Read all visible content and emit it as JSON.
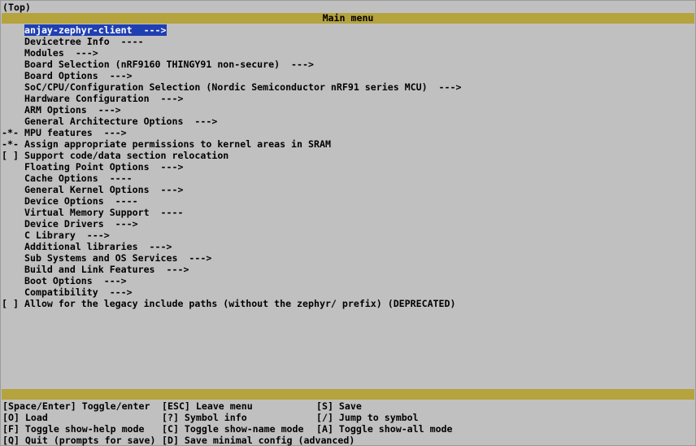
{
  "breadcrumb": "(Top)",
  "title": "Main menu",
  "menu": [
    {
      "prefix": "",
      "text": "anjay-zephyr-client  --->",
      "selected": true
    },
    {
      "prefix": "",
      "text": "Devicetree Info  ----"
    },
    {
      "prefix": "",
      "text": "Modules  --->"
    },
    {
      "prefix": "",
      "text": "Board Selection (nRF9160 THINGY91 non-secure)  --->"
    },
    {
      "prefix": "",
      "text": "Board Options  --->"
    },
    {
      "prefix": "",
      "text": "SoC/CPU/Configuration Selection (Nordic Semiconductor nRF91 series MCU)  --->"
    },
    {
      "prefix": "",
      "text": "Hardware Configuration  --->"
    },
    {
      "prefix": "",
      "text": "ARM Options  --->"
    },
    {
      "prefix": "",
      "text": "General Architecture Options  --->"
    },
    {
      "prefix": "-*-",
      "text": "MPU features  --->"
    },
    {
      "prefix": "-*-",
      "text": "Assign appropriate permissions to kernel areas in SRAM"
    },
    {
      "prefix": "[ ]",
      "text": "Support code/data section relocation"
    },
    {
      "prefix": "",
      "text": "Floating Point Options  --->"
    },
    {
      "prefix": "",
      "text": "Cache Options  ----"
    },
    {
      "prefix": "",
      "text": "General Kernel Options  --->"
    },
    {
      "prefix": "",
      "text": "Device Options  ----"
    },
    {
      "prefix": "",
      "text": "Virtual Memory Support  ----"
    },
    {
      "prefix": "",
      "text": "Device Drivers  --->"
    },
    {
      "prefix": "",
      "text": "C Library  --->"
    },
    {
      "prefix": "",
      "text": "Additional libraries  --->"
    },
    {
      "prefix": "",
      "text": "Sub Systems and OS Services  --->"
    },
    {
      "prefix": "",
      "text": "Build and Link Features  --->"
    },
    {
      "prefix": "",
      "text": "Boot Options  --->"
    },
    {
      "prefix": "",
      "text": "Compatibility  --->"
    },
    {
      "prefix": "[ ]",
      "text": "Allow for the legacy include paths (without the zephyr/ prefix) (DEPRECATED)"
    }
  ],
  "help": [
    [
      "[Space/Enter] Toggle/enter",
      "[ESC] Leave menu",
      "[S] Save"
    ],
    [
      "[O] Load",
      "[?] Symbol info",
      "[/] Jump to symbol"
    ],
    [
      "[F] Toggle show-help mode",
      "[C] Toggle show-name mode",
      "[A] Toggle show-all mode"
    ],
    [
      "[Q] Quit (prompts for save)",
      "[D] Save minimal config (advanced)",
      ""
    ]
  ],
  "colors": {
    "background": "#c0c0c0",
    "title_bar": "#b5a33e",
    "selection": "#1f3fb3"
  }
}
